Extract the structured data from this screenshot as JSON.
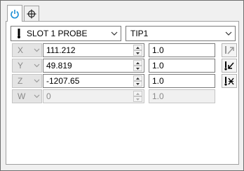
{
  "tabs": [
    {
      "icon": "power-icon",
      "active": true
    },
    {
      "icon": "crosshair-icon",
      "active": false
    }
  ],
  "probe": {
    "icon": "probe-icon",
    "selected": "SLOT 1 PROBE"
  },
  "tip": {
    "selected": "TIP1"
  },
  "axes": [
    {
      "label": "X",
      "value": "111.212",
      "weight": "1.0",
      "enabled": true
    },
    {
      "label": "Y",
      "value": "49.819",
      "weight": "1.0",
      "enabled": true
    },
    {
      "label": "Z",
      "value": "-1207.65",
      "weight": "1.0",
      "enabled": true
    },
    {
      "label": "W",
      "value": "0",
      "weight": "1.0",
      "enabled": false
    }
  ],
  "tools": [
    {
      "icon": "probe-direction-up-icon",
      "enabled": false
    },
    {
      "icon": "probe-direction-down-icon",
      "enabled": true
    },
    {
      "icon": "probe-cross-icon",
      "enabled": true
    }
  ]
}
